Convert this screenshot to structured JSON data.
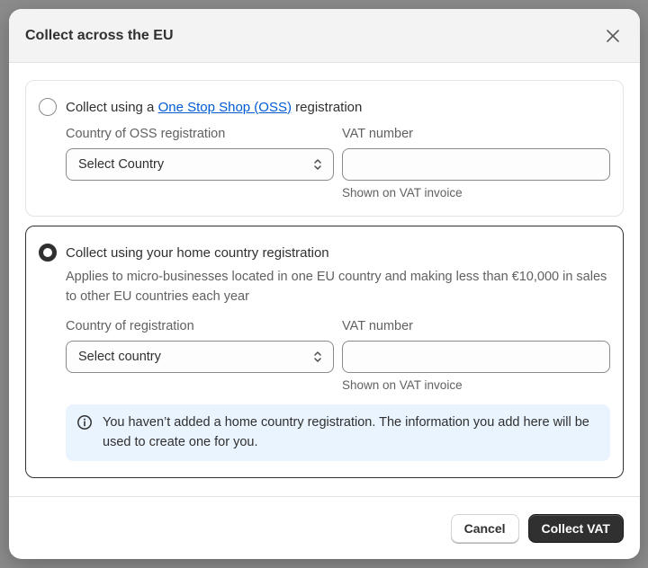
{
  "modal": {
    "title": "Collect across the EU"
  },
  "oss_option": {
    "label_prefix": "Collect using a",
    "link_text": "One Stop Shop (OSS)",
    "label_suffix": "registration",
    "selected": false,
    "country_label": "Country of OSS registration",
    "country_value": "Select Country",
    "vat_label": "VAT number",
    "vat_value": "",
    "vat_help": "Shown on VAT invoice"
  },
  "home_option": {
    "label": "Collect using your home country registration",
    "selected": true,
    "description": "Applies to micro-businesses located in one EU country and making less than €10,000 in sales to other EU countries each year",
    "country_label": "Country of registration",
    "country_value": "Select country",
    "vat_label": "VAT number",
    "vat_value": "",
    "vat_help": "Shown on VAT invoice",
    "banner_icon": "info-icon",
    "banner_text": "You haven’t added a home country registration. The information you add here will be used to create one for you."
  },
  "footer": {
    "cancel_label": "Cancel",
    "submit_label": "Collect VAT"
  },
  "colors": {
    "accent": "#303030",
    "link": "#005bd3",
    "banner_bg": "#eaf4ff"
  }
}
